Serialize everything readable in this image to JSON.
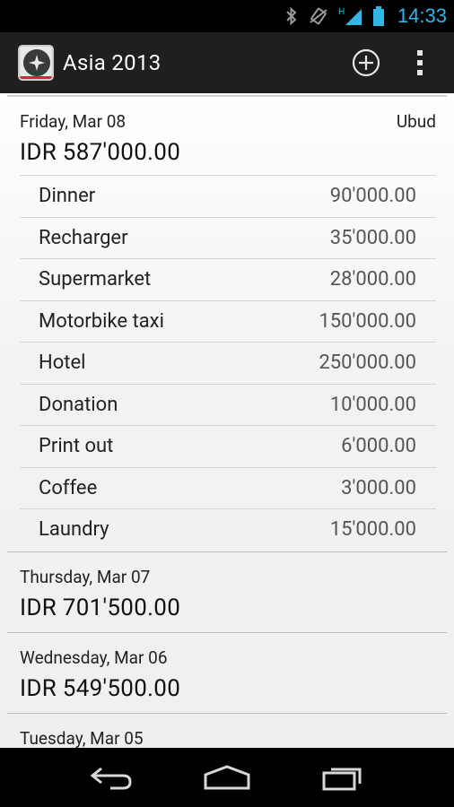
{
  "status_bar": {
    "time": "14:33",
    "network_label": "H",
    "icons": [
      "bluetooth-icon",
      "vibrate-icon",
      "signal-icon",
      "battery-icon"
    ]
  },
  "action_bar": {
    "title": "Asia 2013",
    "icons": [
      "app-logo-icon",
      "add-circle-icon",
      "overflow-menu-icon"
    ]
  },
  "days": [
    {
      "date": "Friday, Mar 08",
      "place": "Ubud",
      "total": "IDR 587'000.00",
      "items": [
        {
          "name": "Dinner",
          "amount": "90'000.00"
        },
        {
          "name": "Recharger",
          "amount": "35'000.00"
        },
        {
          "name": "Supermarket",
          "amount": "28'000.00"
        },
        {
          "name": "Motorbike taxi",
          "amount": "150'000.00"
        },
        {
          "name": "Hotel",
          "amount": "250'000.00"
        },
        {
          "name": "Donation",
          "amount": "10'000.00"
        },
        {
          "name": "Print out",
          "amount": "6'000.00"
        },
        {
          "name": "Coffee",
          "amount": "3'000.00"
        },
        {
          "name": "Laundry",
          "amount": "15'000.00"
        }
      ]
    },
    {
      "date": "Thursday, Mar 07",
      "place": "",
      "total": "IDR 701'500.00"
    },
    {
      "date": "Wednesday, Mar 06",
      "place": "",
      "total": "IDR 549'500.00"
    },
    {
      "date": "Tuesday, Mar 05",
      "place": "",
      "total": ""
    }
  ],
  "nav_bar": {
    "icons": [
      "back-icon",
      "home-icon",
      "recent-apps-icon"
    ]
  },
  "colors": {
    "status_accent": "#33b5e5",
    "action_bar_bg": "#1f1f1f"
  }
}
